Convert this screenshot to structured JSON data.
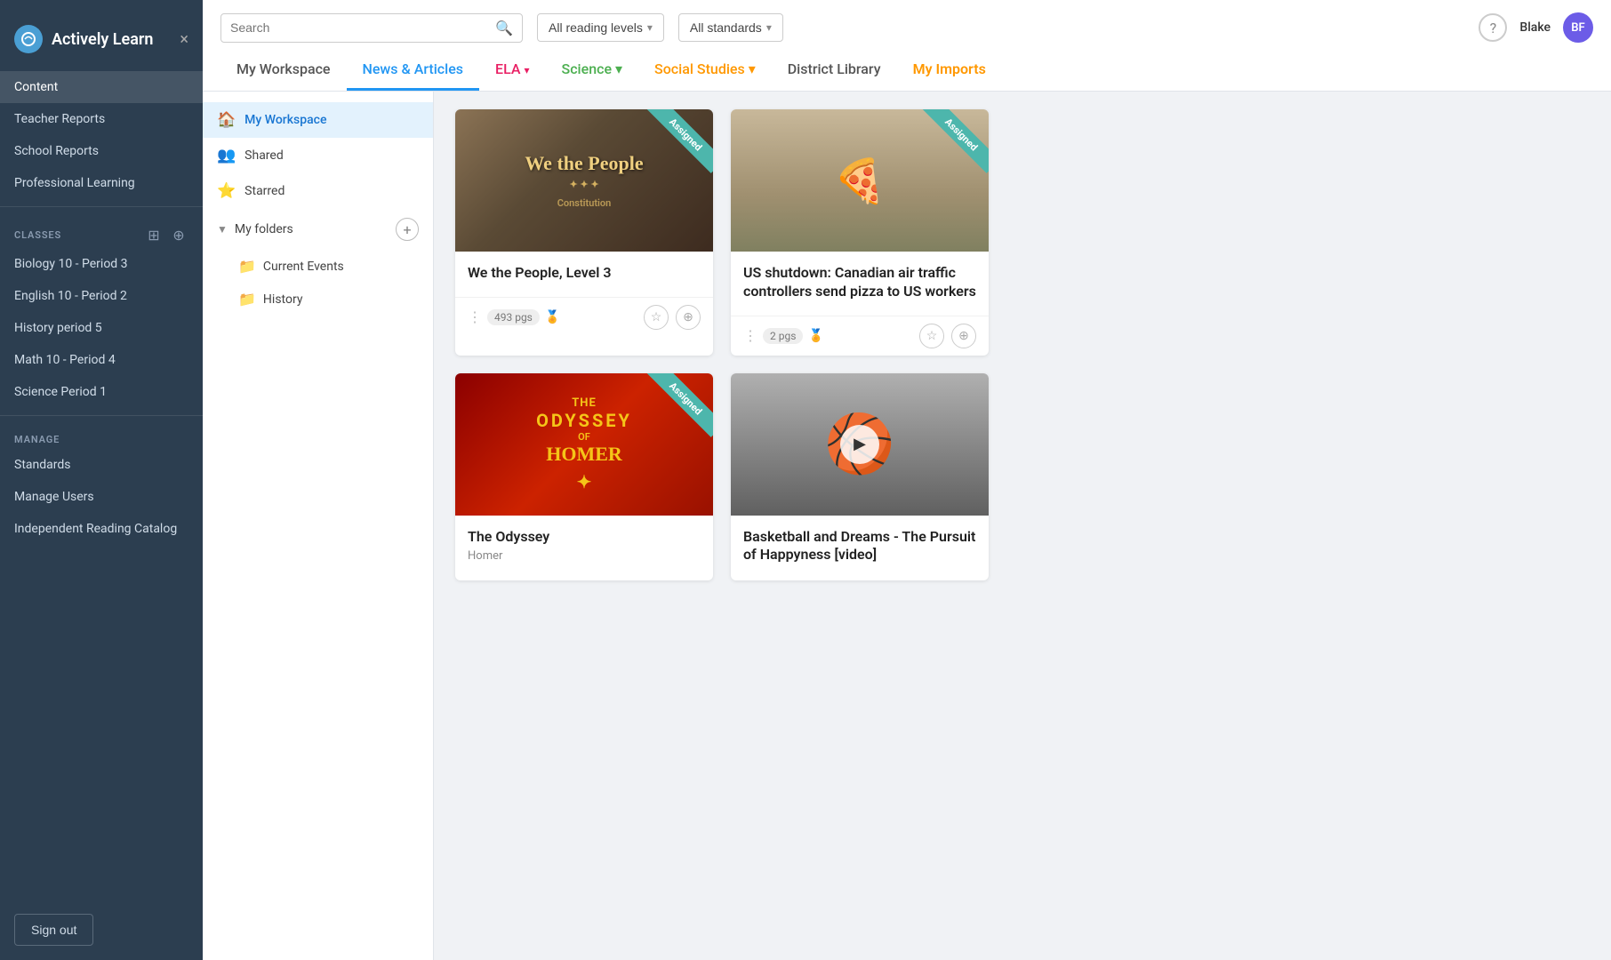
{
  "sidebar": {
    "app_title": "Actively Learn",
    "close_label": "×",
    "nav": [
      {
        "label": "Content",
        "id": "content",
        "active": true
      },
      {
        "label": "Teacher Reports",
        "id": "teacher-reports"
      },
      {
        "label": "School Reports",
        "id": "school-reports"
      },
      {
        "label": "Professional Learning",
        "id": "professional-learning"
      }
    ],
    "classes_section": "CLASSES",
    "classes": [
      {
        "label": "Biology 10 - Period 3"
      },
      {
        "label": "English 10 - Period 2"
      },
      {
        "label": "History period 5"
      },
      {
        "label": "Math 10 - Period 4"
      },
      {
        "label": "Science Period 1"
      }
    ],
    "manage_section": "MANAGE",
    "manage_items": [
      {
        "label": "Standards"
      },
      {
        "label": "Manage Users"
      },
      {
        "label": "Independent Reading Catalog"
      }
    ],
    "sign_out": "Sign out"
  },
  "topbar": {
    "search_placeholder": "Search",
    "filter1_label": "All reading levels",
    "filter2_label": "All standards",
    "user_name": "Blake",
    "user_initials": "BF"
  },
  "nav_tabs": [
    {
      "label": "My Workspace",
      "id": "my-workspace"
    },
    {
      "label": "News & Articles",
      "id": "news-articles",
      "active": true
    },
    {
      "label": "ELA",
      "id": "ela",
      "dropdown": true
    },
    {
      "label": "Science",
      "id": "science",
      "dropdown": true
    },
    {
      "label": "Social Studies",
      "id": "social-studies",
      "dropdown": true
    },
    {
      "label": "District Library",
      "id": "district-library"
    },
    {
      "label": "My Imports",
      "id": "my-imports"
    }
  ],
  "left_panel": {
    "items": [
      {
        "label": "My Workspace",
        "id": "my-workspace",
        "active": true,
        "icon": "🏠"
      },
      {
        "label": "Shared",
        "id": "shared",
        "icon": "👥"
      },
      {
        "label": "Starred",
        "id": "starred",
        "icon": "⭐"
      }
    ],
    "folders_label": "My folders",
    "folders": [
      {
        "label": "Current Events"
      },
      {
        "label": "History"
      }
    ]
  },
  "cards": [
    {
      "id": "we-the-people",
      "title": "We the People, Level 3",
      "subtitle": "",
      "pages": "493 pgs",
      "assigned": true,
      "type": "document"
    },
    {
      "id": "us-shutdown",
      "title": "US shutdown: Canadian air traffic controllers send pizza to US workers",
      "subtitle": "",
      "pages": "2 pgs",
      "assigned": true,
      "type": "article"
    },
    {
      "id": "the-odyssey",
      "title": "The Odyssey",
      "subtitle": "Homer",
      "pages": "",
      "assigned": true,
      "type": "book"
    },
    {
      "id": "basketball-dreams",
      "title": "Basketball and Dreams - The Pursuit of Happyness [video]",
      "subtitle": "",
      "pages": "",
      "assigned": false,
      "type": "video"
    }
  ]
}
